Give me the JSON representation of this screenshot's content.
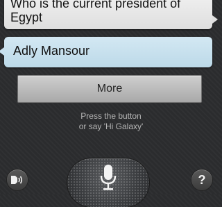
{
  "conversation": {
    "question": "Who is the current president of Egypt",
    "answer": "Adly Mansour"
  },
  "actions": {
    "more_label": "More"
  },
  "hint": {
    "line1": "Press the button",
    "line2": "or say 'Hi Galaxy'"
  },
  "controls": {
    "left_icon": "speaker-feedback-icon",
    "mic_icon": "microphone-icon",
    "help_label": "?"
  },
  "colors": {
    "background": "#2b2c2e",
    "answer_bubble": "#c6dfec",
    "question_bubble": "#e8e8e8",
    "button": "#bcbcbc"
  }
}
